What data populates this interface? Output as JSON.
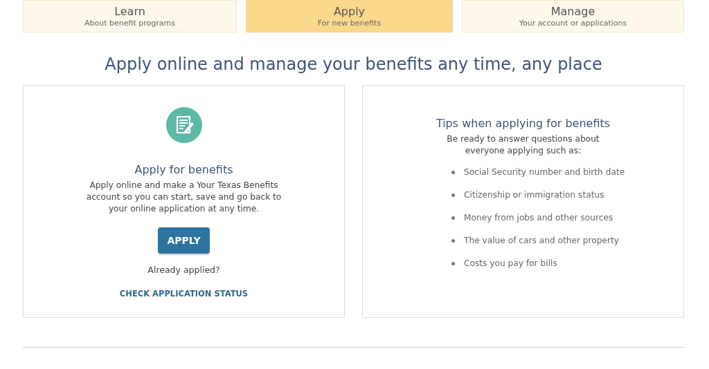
{
  "tabs": [
    {
      "label": "Learn",
      "sublabel": "About benefit programs",
      "selected": false
    },
    {
      "label": "Apply",
      "sublabel": "For new benefits",
      "selected": true
    },
    {
      "label": "Manage",
      "sublabel": "Your account or applications",
      "selected": false
    }
  ],
  "heading": "Apply online and manage your benefits any time, any place",
  "apply_card": {
    "title": "Apply for benefits",
    "description": "Apply online and make a Your Texas Benefits account so you can start, save and go back to your online application at any time.",
    "button": "APPLY",
    "prompt": "Already applied?",
    "link": "CHECK APPLICATION STATUS"
  },
  "tips_card": {
    "title": "Tips when applying for benefits",
    "intro": "Be ready to answer questions about everyone applying such as:",
    "items": [
      "Social Security number and birth date",
      "Citizenship or immigration status",
      "Money from jobs and other sources",
      "The value of cars and other property",
      "Costs you pay for bills"
    ]
  }
}
